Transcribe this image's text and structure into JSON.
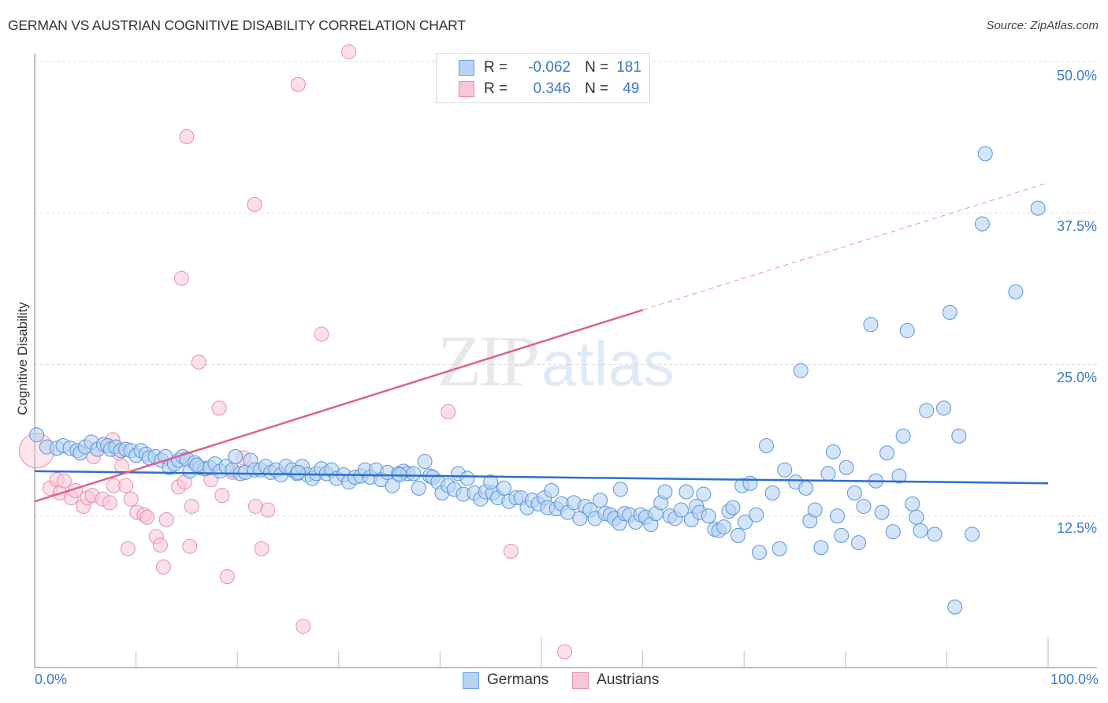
{
  "header": {
    "title": "GERMAN VS AUSTRIAN COGNITIVE DISABILITY CORRELATION CHART",
    "source": "Source: ZipAtlas.com"
  },
  "legend": {
    "rows": [
      {
        "series": "Germans",
        "r_label": "R =",
        "r_value": "-0.062",
        "n_label": "N =",
        "n_value": "181"
      },
      {
        "series": "Austrians",
        "r_label": "R =",
        "r_value": "0.346",
        "n_label": "N =",
        "n_value": "49"
      }
    ]
  },
  "watermark": {
    "zip": "ZIP",
    "atlas": "atlas"
  },
  "colors": {
    "germans_fill": "#b8d3f5",
    "germans_stroke": "#5b93d9",
    "germans_line": "#2a6fcf",
    "austrians_fill": "#f9c6d6",
    "austrians_stroke": "#e58fab",
    "austrians_line": "#e0608c",
    "axis_label": "#3b78c9",
    "grid": "#dddddd"
  },
  "chart_data": {
    "type": "scatter",
    "title": "GERMAN VS AUSTRIAN COGNITIVE DISABILITY CORRELATION CHART",
    "xlabel": "",
    "ylabel": "Cognitive Disability",
    "xlim": [
      0,
      100
    ],
    "ylim": [
      0,
      50
    ],
    "x_tick_labels": [
      "0.0%",
      "100.0%"
    ],
    "y_ticks": [
      12.5,
      25.0,
      37.5,
      50.0
    ],
    "y_tick_labels": [
      "12.5%",
      "25.0%",
      "37.5%",
      "50.0%"
    ],
    "grid": true,
    "legend_position": "bottom-center",
    "series": [
      {
        "name": "Germans",
        "R": -0.062,
        "N": 181,
        "trendline": {
          "x": [
            0,
            100
          ],
          "y": [
            16.2,
            15.2
          ],
          "style": "solid"
        },
        "points": [
          [
            0.2,
            19.2
          ],
          [
            1.2,
            18.2
          ],
          [
            2.2,
            18.1
          ],
          [
            2.8,
            18.3
          ],
          [
            3.5,
            18.1
          ],
          [
            4.2,
            17.9
          ],
          [
            4.5,
            17.7
          ],
          [
            5.0,
            18.2
          ],
          [
            5.6,
            18.6
          ],
          [
            6.2,
            18.0
          ],
          [
            6.8,
            18.4
          ],
          [
            7.2,
            18.3
          ],
          [
            7.5,
            18.0
          ],
          [
            8.0,
            18.2
          ],
          [
            8.5,
            17.9
          ],
          [
            9.0,
            18.0
          ],
          [
            9.5,
            17.9
          ],
          [
            10.0,
            17.5
          ],
          [
            10.5,
            17.9
          ],
          [
            11.0,
            17.6
          ],
          [
            11.3,
            17.3
          ],
          [
            11.9,
            17.4
          ],
          [
            12.5,
            17.1
          ],
          [
            12.9,
            17.4
          ],
          [
            13.3,
            16.5
          ],
          [
            13.8,
            16.8
          ],
          [
            14.2,
            17.1
          ],
          [
            14.6,
            17.4
          ],
          [
            15.0,
            17.2
          ],
          [
            15.3,
            16.2
          ],
          [
            15.8,
            16.9
          ],
          [
            16.3,
            16.5
          ],
          [
            16.8,
            16.4
          ],
          [
            17.3,
            16.5
          ],
          [
            17.8,
            16.8
          ],
          [
            18.3,
            16.2
          ],
          [
            18.9,
            16.6
          ],
          [
            19.5,
            16.3
          ],
          [
            19.8,
            17.4
          ],
          [
            20.3,
            16.0
          ],
          [
            20.8,
            16.1
          ],
          [
            21.3,
            17.1
          ],
          [
            21.7,
            16.3
          ],
          [
            22.3,
            16.3
          ],
          [
            22.8,
            16.6
          ],
          [
            23.3,
            16.1
          ],
          [
            23.8,
            16.3
          ],
          [
            24.3,
            15.9
          ],
          [
            24.8,
            16.6
          ],
          [
            25.4,
            16.3
          ],
          [
            25.9,
            16.0
          ],
          [
            26.4,
            16.6
          ],
          [
            26.9,
            15.9
          ],
          [
            27.4,
            15.6
          ],
          [
            27.8,
            16.0
          ],
          [
            28.3,
            16.4
          ],
          [
            28.8,
            16.0
          ],
          [
            29.3,
            16.3
          ],
          [
            29.8,
            15.6
          ],
          [
            30.5,
            15.9
          ],
          [
            31.0,
            15.3
          ],
          [
            31.6,
            15.7
          ],
          [
            32.2,
            15.8
          ],
          [
            32.6,
            16.3
          ],
          [
            33.1,
            15.7
          ],
          [
            33.7,
            16.3
          ],
          [
            34.2,
            15.5
          ],
          [
            34.8,
            16.1
          ],
          [
            35.3,
            15.0
          ],
          [
            35.9,
            16.0
          ],
          [
            36.4,
            16.2
          ],
          [
            36.8,
            16.0
          ],
          [
            37.4,
            16.0
          ],
          [
            37.9,
            14.8
          ],
          [
            38.5,
            17.0
          ],
          [
            39.0,
            15.8
          ],
          [
            39.3,
            15.7
          ],
          [
            39.8,
            15.3
          ],
          [
            40.2,
            14.4
          ],
          [
            40.8,
            15.0
          ],
          [
            41.4,
            14.7
          ],
          [
            41.8,
            16.0
          ],
          [
            42.3,
            14.3
          ],
          [
            42.7,
            15.6
          ],
          [
            43.4,
            14.4
          ],
          [
            44.0,
            13.9
          ],
          [
            44.5,
            14.5
          ],
          [
            45.2,
            14.4
          ],
          [
            45.7,
            14.0
          ],
          [
            46.3,
            14.8
          ],
          [
            46.8,
            13.7
          ],
          [
            47.5,
            14.0
          ],
          [
            48.0,
            14.0
          ],
          [
            48.6,
            13.2
          ],
          [
            49.1,
            13.8
          ],
          [
            49.7,
            13.5
          ],
          [
            50.3,
            14.0
          ],
          [
            50.6,
            13.2
          ],
          [
            51.0,
            14.6
          ],
          [
            51.5,
            13.1
          ],
          [
            52.0,
            13.5
          ],
          [
            52.6,
            12.8
          ],
          [
            53.2,
            13.6
          ],
          [
            53.8,
            12.3
          ],
          [
            54.3,
            13.3
          ],
          [
            54.8,
            13.0
          ],
          [
            55.3,
            12.3
          ],
          [
            55.8,
            13.8
          ],
          [
            56.3,
            12.7
          ],
          [
            56.8,
            12.6
          ],
          [
            57.2,
            12.3
          ],
          [
            57.7,
            11.9
          ],
          [
            58.2,
            12.7
          ],
          [
            58.7,
            12.6
          ],
          [
            59.3,
            12.0
          ],
          [
            59.8,
            12.6
          ],
          [
            60.3,
            12.4
          ],
          [
            60.8,
            11.8
          ],
          [
            61.3,
            12.7
          ],
          [
            61.8,
            13.6
          ],
          [
            62.2,
            14.5
          ],
          [
            62.7,
            12.5
          ],
          [
            63.2,
            12.3
          ],
          [
            63.8,
            13.0
          ],
          [
            64.3,
            14.5
          ],
          [
            64.8,
            12.2
          ],
          [
            65.3,
            13.3
          ],
          [
            65.6,
            12.8
          ],
          [
            66.0,
            14.3
          ],
          [
            66.5,
            12.5
          ],
          [
            67.1,
            11.4
          ],
          [
            67.5,
            11.3
          ],
          [
            68.0,
            11.6
          ],
          [
            68.5,
            12.9
          ],
          [
            68.9,
            13.2
          ],
          [
            69.4,
            10.9
          ],
          [
            69.8,
            15.0
          ],
          [
            70.1,
            12.0
          ],
          [
            70.6,
            15.2
          ],
          [
            71.2,
            12.6
          ],
          [
            71.5,
            9.5
          ],
          [
            72.2,
            18.3
          ],
          [
            72.8,
            14.4
          ],
          [
            73.5,
            9.8
          ],
          [
            74.0,
            16.3
          ],
          [
            75.1,
            15.3
          ],
          [
            75.6,
            24.5
          ],
          [
            76.1,
            14.8
          ],
          [
            76.5,
            12.1
          ],
          [
            77.0,
            13.0
          ],
          [
            77.6,
            9.9
          ],
          [
            78.3,
            16.0
          ],
          [
            78.8,
            17.8
          ],
          [
            79.2,
            12.5
          ],
          [
            79.6,
            10.9
          ],
          [
            80.1,
            16.5
          ],
          [
            80.9,
            14.4
          ],
          [
            81.3,
            10.3
          ],
          [
            81.8,
            13.3
          ],
          [
            82.5,
            28.3
          ],
          [
            83.0,
            15.4
          ],
          [
            83.6,
            12.8
          ],
          [
            84.1,
            17.7
          ],
          [
            84.7,
            11.2
          ],
          [
            85.3,
            15.8
          ],
          [
            85.7,
            19.1
          ],
          [
            86.1,
            27.8
          ],
          [
            86.6,
            13.5
          ],
          [
            87.0,
            12.4
          ],
          [
            87.4,
            11.3
          ],
          [
            88.0,
            21.2
          ],
          [
            88.8,
            11.0
          ],
          [
            89.7,
            21.4
          ],
          [
            90.3,
            29.3
          ],
          [
            90.8,
            5.0
          ],
          [
            91.2,
            19.1
          ],
          [
            92.5,
            11.0
          ],
          [
            93.5,
            36.6
          ],
          [
            93.8,
            42.4
          ],
          [
            96.8,
            31.0
          ],
          [
            99.0,
            37.9
          ],
          [
            57.8,
            14.7
          ],
          [
            45.0,
            15.3
          ],
          [
            36.0,
            15.9
          ],
          [
            26.0,
            16.1
          ],
          [
            16.0,
            16.7
          ]
        ]
      },
      {
        "name": "Austrians",
        "R": 0.346,
        "N": 49,
        "trendline": {
          "x": [
            0,
            60
          ],
          "y": [
            13.7,
            29.5
          ],
          "extended": {
            "x": [
              60,
              100
            ],
            "y": [
              29.5,
              40.0
            ]
          },
          "style": "solid-then-dashed"
        },
        "points": [
          [
            0.2,
            17.9
          ],
          [
            1.5,
            14.8
          ],
          [
            2.2,
            15.5
          ],
          [
            2.5,
            14.4
          ],
          [
            2.9,
            15.4
          ],
          [
            3.6,
            14.0
          ],
          [
            4.0,
            14.6
          ],
          [
            4.8,
            13.3
          ],
          [
            5.2,
            14.0
          ],
          [
            5.7,
            14.2
          ],
          [
            6.7,
            13.9
          ],
          [
            5.8,
            17.4
          ],
          [
            7.4,
            13.6
          ],
          [
            7.7,
            18.8
          ],
          [
            7.8,
            15.0
          ],
          [
            8.3,
            17.7
          ],
          [
            8.6,
            16.6
          ],
          [
            9.0,
            15.0
          ],
          [
            9.2,
            9.8
          ],
          [
            9.5,
            13.9
          ],
          [
            10.1,
            12.8
          ],
          [
            10.8,
            12.6
          ],
          [
            11.1,
            12.4
          ],
          [
            12.0,
            10.8
          ],
          [
            12.4,
            10.1
          ],
          [
            12.7,
            8.3
          ],
          [
            13.0,
            12.2
          ],
          [
            14.2,
            14.9
          ],
          [
            14.5,
            32.1
          ],
          [
            14.8,
            15.3
          ],
          [
            15.0,
            43.8
          ],
          [
            15.3,
            10.0
          ],
          [
            15.5,
            13.3
          ],
          [
            16.2,
            25.2
          ],
          [
            17.4,
            15.5
          ],
          [
            18.2,
            21.4
          ],
          [
            18.5,
            14.2
          ],
          [
            19.0,
            7.5
          ],
          [
            19.5,
            16.1
          ],
          [
            20.6,
            17.3
          ],
          [
            21.7,
            38.2
          ],
          [
            21.8,
            13.3
          ],
          [
            22.4,
            9.8
          ],
          [
            23.0,
            13.0
          ],
          [
            26.0,
            48.1
          ],
          [
            26.5,
            3.4
          ],
          [
            28.3,
            27.5
          ],
          [
            31.0,
            50.8
          ],
          [
            40.8,
            21.1
          ],
          [
            47.0,
            9.6
          ],
          [
            52.3,
            1.3
          ]
        ]
      }
    ]
  },
  "x_axis": {
    "min_label": "0.0%",
    "max_label": "100.0%"
  },
  "bottom_legend": {
    "items": [
      "Germans",
      "Austrians"
    ]
  }
}
